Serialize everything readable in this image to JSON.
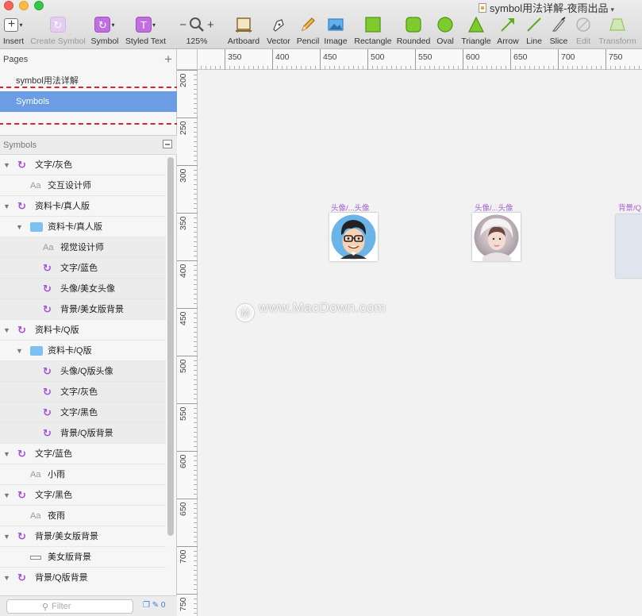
{
  "window": {
    "document_title": "symbol用法详解-夜雨出品",
    "traffic_lights": [
      "#fc605b",
      "#fdbc40",
      "#34c84a"
    ]
  },
  "toolbar": {
    "insert": "Insert",
    "create_symbol": "Create Symbol",
    "symbol": "Symbol",
    "styled_text": "Styled Text",
    "zoom": "125%",
    "zoom_minus": "−",
    "zoom_plus": "+",
    "artboard": "Artboard",
    "vector": "Vector",
    "pencil": "Pencil",
    "image": "Image",
    "rectangle": "Rectangle",
    "rounded": "Rounded",
    "oval": "Oval",
    "triangle": "Triangle",
    "arrow": "Arrow",
    "line": "Line",
    "slice": "Slice",
    "edit": "Edit",
    "transform": "Transform"
  },
  "pages": {
    "header": "Pages",
    "add": "+",
    "items": [
      {
        "label": "symbol用法详解",
        "selected": false
      },
      {
        "label": "Symbols",
        "selected": true
      }
    ]
  },
  "symbols_panel": {
    "header": "Symbols",
    "layers": [
      {
        "type": "symbol",
        "label": "文字/灰色",
        "depth": 0,
        "expanded": true
      },
      {
        "type": "text",
        "label": "交互设计师",
        "depth": 1
      },
      {
        "type": "symbol",
        "label": "资料卡/真人版",
        "depth": 0,
        "expanded": true
      },
      {
        "type": "folder",
        "label": "资料卡/真人版",
        "depth": 1,
        "expanded": true
      },
      {
        "type": "text",
        "label": "视觉设计师",
        "depth": 2
      },
      {
        "type": "symbol",
        "label": "文字/蓝色",
        "depth": 2
      },
      {
        "type": "symbol",
        "label": "头像/美女头像",
        "depth": 2
      },
      {
        "type": "symbol",
        "label": "背景/美女版背景",
        "depth": 2
      },
      {
        "type": "symbol",
        "label": "资料卡/Q版",
        "depth": 0,
        "expanded": true
      },
      {
        "type": "folder",
        "label": "资料卡/Q版",
        "depth": 1,
        "expanded": true
      },
      {
        "type": "symbol",
        "label": "头像/Q版头像",
        "depth": 2
      },
      {
        "type": "symbol",
        "label": "文字/灰色",
        "depth": 2
      },
      {
        "type": "symbol",
        "label": "文字/黑色",
        "depth": 2
      },
      {
        "type": "symbol",
        "label": "背景/Q版背景",
        "depth": 2
      },
      {
        "type": "symbol",
        "label": "文字/蓝色",
        "depth": 0,
        "expanded": true
      },
      {
        "type": "text",
        "label": "小雨",
        "depth": 1
      },
      {
        "type": "symbol",
        "label": "文字/黑色",
        "depth": 0,
        "expanded": true
      },
      {
        "type": "text",
        "label": "夜雨",
        "depth": 1
      },
      {
        "type": "symbol",
        "label": "背景/美女版背景",
        "depth": 0,
        "expanded": true
      },
      {
        "type": "rect",
        "label": "美女版背景",
        "depth": 1
      },
      {
        "type": "symbol",
        "label": "背景/Q版背景",
        "depth": 0,
        "expanded": true
      }
    ],
    "filter_placeholder": "Filter",
    "filter_count": "0"
  },
  "ruler": {
    "top_labels": [
      "350",
      "400",
      "450",
      "500",
      "550",
      "600",
      "650",
      "700",
      "750"
    ],
    "left_labels": [
      "200",
      "250",
      "300",
      "350",
      "400",
      "450",
      "500",
      "550",
      "600",
      "650",
      "700",
      "750"
    ]
  },
  "canvas": {
    "artboards": [
      {
        "label": "头像/...头像",
        "kind": "cartoon-avatar"
      },
      {
        "label": "头像/...头像",
        "kind": "photo-avatar"
      },
      {
        "label": "背景/Q",
        "kind": "background"
      }
    ],
    "watermark": "www.MacDown.com",
    "watermark_logo": "M"
  },
  "colors": {
    "accent_symbol": "#c16fe0",
    "selected_page": "#6a9de3",
    "artboard_label": "#a55fcf",
    "annotation": "#d62430"
  }
}
